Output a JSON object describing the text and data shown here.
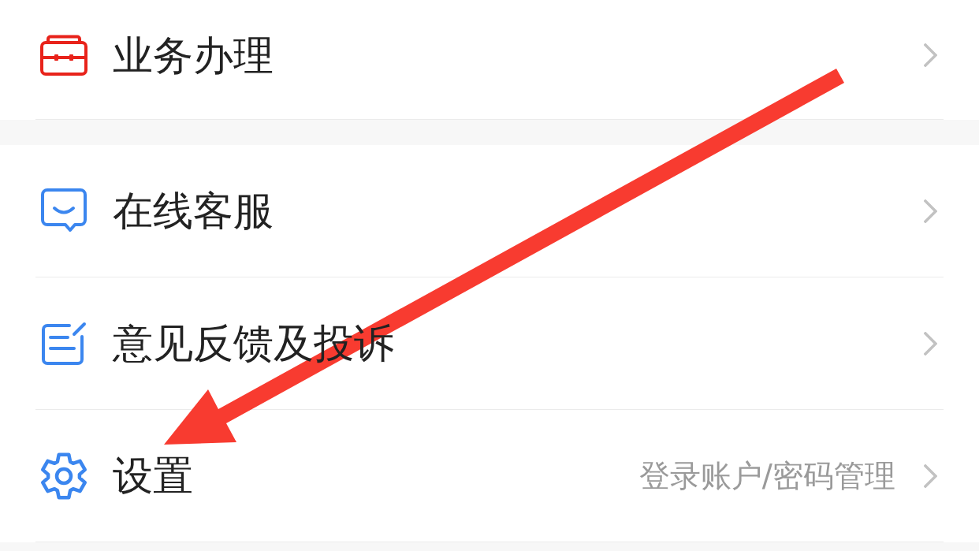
{
  "groups": [
    {
      "items": [
        {
          "label": "业务办理"
        }
      ]
    },
    {
      "items": [
        {
          "label": "在线客服"
        },
        {
          "label": "意见反馈及投诉"
        },
        {
          "label": "设置",
          "detail": "登录账户/密码管理"
        }
      ]
    }
  ],
  "annotations": [
    {
      "kind": "arrow"
    }
  ]
}
